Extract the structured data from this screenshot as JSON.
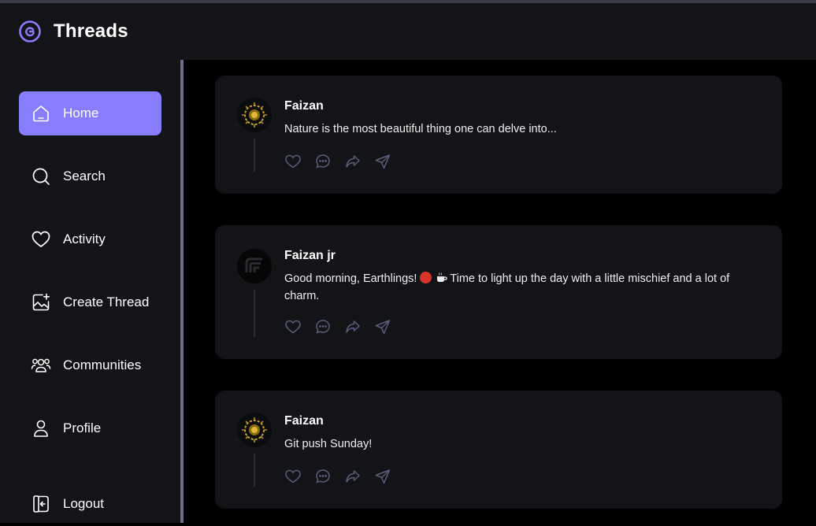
{
  "app": {
    "title": "Threads"
  },
  "sidebar": {
    "items": [
      {
        "label": "Home",
        "icon": "home-icon",
        "active": true
      },
      {
        "label": "Search",
        "icon": "search-icon",
        "active": false
      },
      {
        "label": "Activity",
        "icon": "heart-icon",
        "active": false
      },
      {
        "label": "Create Thread",
        "icon": "create-image-icon",
        "active": false
      },
      {
        "label": "Communities",
        "icon": "people-icon",
        "active": false
      },
      {
        "label": "Profile",
        "icon": "user-icon",
        "active": false
      }
    ],
    "logout": {
      "label": "Logout",
      "icon": "logout-icon"
    }
  },
  "threads": [
    {
      "author": "Faizan",
      "text": "Nature is the most beautiful thing one can delve into..."
    },
    {
      "author": "Faizan jr",
      "text_before": "Good morning, Earthlings! ",
      "text_after": " Time to light up the day with a little mischief and a lot of charm."
    },
    {
      "author": "Faizan",
      "text": "Git push Sunday!"
    }
  ],
  "colors": {
    "accent": "#877eff",
    "panel": "#121417",
    "background": "#000000",
    "icon_muted": "#5c5c7b",
    "divider": "#6e6f86"
  }
}
